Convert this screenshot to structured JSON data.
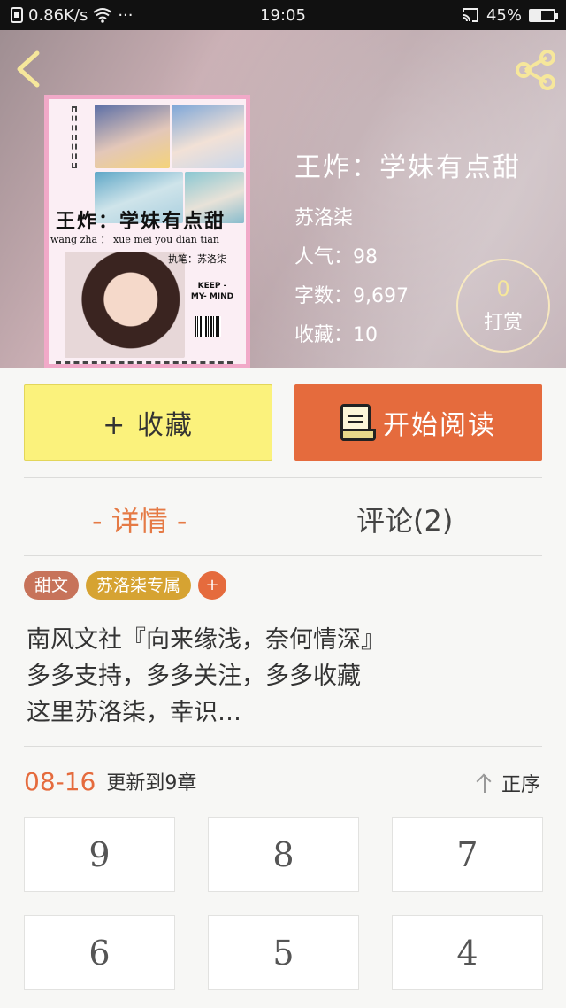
{
  "status_bar": {
    "network_speed": "0.86K/s",
    "more": "···",
    "time": "19:05",
    "battery": "45%",
    "battery_level": 0.45
  },
  "book": {
    "title": "王炸：学妹有点甜",
    "author": "苏洛柒",
    "popularity": "人气：98",
    "word_count": "字数：9,697",
    "favorites": "收藏：10",
    "reward_count": "0",
    "reward_label": "打赏",
    "cover": {
      "title": "王炸：学妹有点甜",
      "subtitle": "wang zha ： xue mei you dian tian",
      "author": "执笔：苏洛柒",
      "keep_text": "KEEP -MY- MIND"
    }
  },
  "actions": {
    "collect_label": "+ 收藏",
    "read_label": "开始阅读"
  },
  "tabs": {
    "details": "- 详情 -",
    "comments": "评论(2)"
  },
  "tags": [
    "甜文",
    "苏洛柒专属"
  ],
  "tag_add": "+",
  "description": [
    "南风文社『向来缘浅，奈何情深』",
    "多多支持，多多关注，多多收藏",
    "这里苏洛柒，幸识…"
  ],
  "update": {
    "date": "08-16",
    "text": "更新到9章",
    "sort_label": "正序"
  },
  "chapters": [
    "9",
    "8",
    "7",
    "6",
    "5",
    "4"
  ],
  "colors": {
    "accent_orange": "#e56b3d",
    "collect_yellow": "#fbf27c",
    "tag_brown": "#c7735a",
    "tag_gold": "#d6a332"
  }
}
